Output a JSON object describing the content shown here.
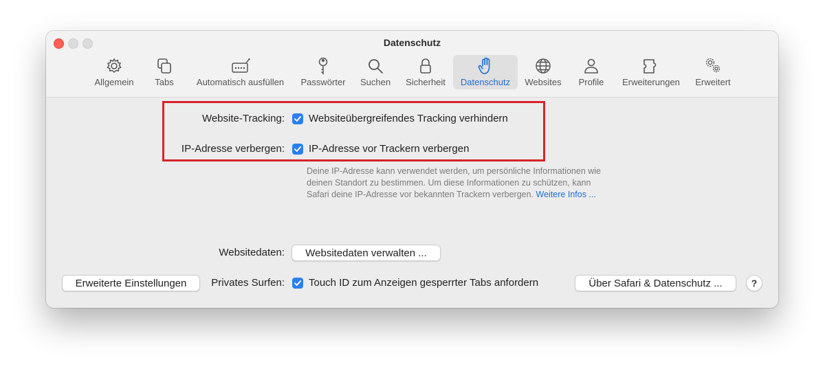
{
  "window": {
    "title": "Datenschutz"
  },
  "tabs": [
    {
      "id": "allgemein",
      "label": "Allgemein",
      "icon": "gear-icon"
    },
    {
      "id": "tabs",
      "label": "Tabs",
      "icon": "tabs-icon"
    },
    {
      "id": "autofill",
      "label": "Automatisch ausfüllen",
      "icon": "autofill-icon"
    },
    {
      "id": "passwords",
      "label": "Passwörter",
      "icon": "key-icon"
    },
    {
      "id": "search",
      "label": "Suchen",
      "icon": "search-icon"
    },
    {
      "id": "security",
      "label": "Sicherheit",
      "icon": "lock-icon"
    },
    {
      "id": "privacy",
      "label": "Datenschutz",
      "icon": "hand-icon",
      "active": true
    },
    {
      "id": "websites",
      "label": "Websites",
      "icon": "globe-icon"
    },
    {
      "id": "profiles",
      "label": "Profile",
      "icon": "person-icon"
    },
    {
      "id": "extensions",
      "label": "Erweiterungen",
      "icon": "puzzle-icon"
    },
    {
      "id": "advanced",
      "label": "Erweitert",
      "icon": "gears-icon"
    }
  ],
  "privacy": {
    "tracking": {
      "label": "Website-Tracking:",
      "option": "Websiteübergreifendes Tracking verhindern",
      "checked": true
    },
    "ip": {
      "label": "IP-Adresse verbergen:",
      "option": "IP-Adresse vor Trackern verbergen",
      "checked": true
    },
    "ip_help": {
      "line1": "Deine IP-Adresse kann verwendet werden, um persönliche Informationen wie",
      "line2": "deinen Standort zu bestimmen. Um diese Informationen zu schützen, kann",
      "line3": "Safari deine IP-Adresse vor bekannten Trackern verbergen.",
      "link": "Weitere Infos ..."
    },
    "website_data": {
      "label": "Websitedaten:",
      "button": "Websitedaten verwalten ..."
    },
    "private_browsing": {
      "label": "Privates Surfen:",
      "option": "Touch ID zum Anzeigen gesperrter Tabs anfordern",
      "checked": true
    }
  },
  "footer": {
    "advanced_button": "Erweiterte Einstellungen",
    "about_button": "Über Safari & Datenschutz ...",
    "help_button": "?"
  },
  "colors": {
    "accent": "#1f6ed8",
    "checkbox": "#2a7ff0",
    "highlight_border": "#d8232a",
    "close_button": "#fe5f57"
  }
}
